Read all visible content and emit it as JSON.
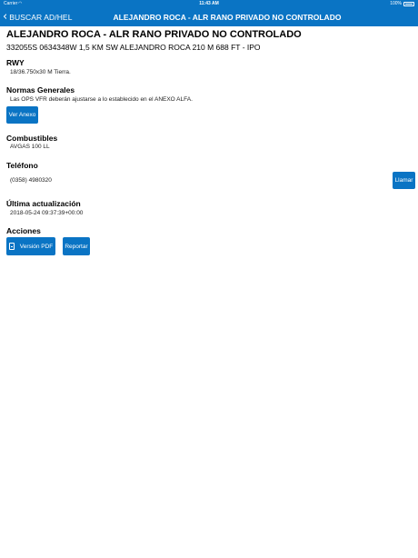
{
  "status": {
    "carrier": "Carrier",
    "time": "11:43 AM",
    "battery_pct": "100%"
  },
  "nav": {
    "back_label": "BUSCAR AD/HEL",
    "title": "ALEJANDRO ROCA - ALR RANO PRIVADO NO CONTROLADO"
  },
  "header": {
    "title": "ALEJANDRO ROCA - ALR RANO PRIVADO NO CONTROLADO",
    "subtitle": "332055S 0634348W 1,5 KM SW ALEJANDRO ROCA 210 M 688 FT - IPO"
  },
  "rwy": {
    "label": "RWY",
    "value": "18/36.750x30 M Tierra."
  },
  "normas": {
    "label": "Normas Generales",
    "value": "Las OPS VFR deberán ajustarse a lo establecido en el ANEXO ALFA.",
    "button": "Ver Anexo"
  },
  "combustibles": {
    "label": "Combustibles",
    "value": "AVGAS 100 LL"
  },
  "telefono": {
    "label": "Teléfono",
    "value": "(0358) 4980320",
    "button": "Llamar"
  },
  "actualizacion": {
    "label": "Última actualización",
    "value": "2018-05-24 09:37:39+00:00"
  },
  "acciones": {
    "label": "Acciones",
    "pdf_button": "Versión PDF",
    "report_button": "Reportar"
  },
  "colors": {
    "accent": "#0a74c4",
    "background": "#ffffff"
  }
}
